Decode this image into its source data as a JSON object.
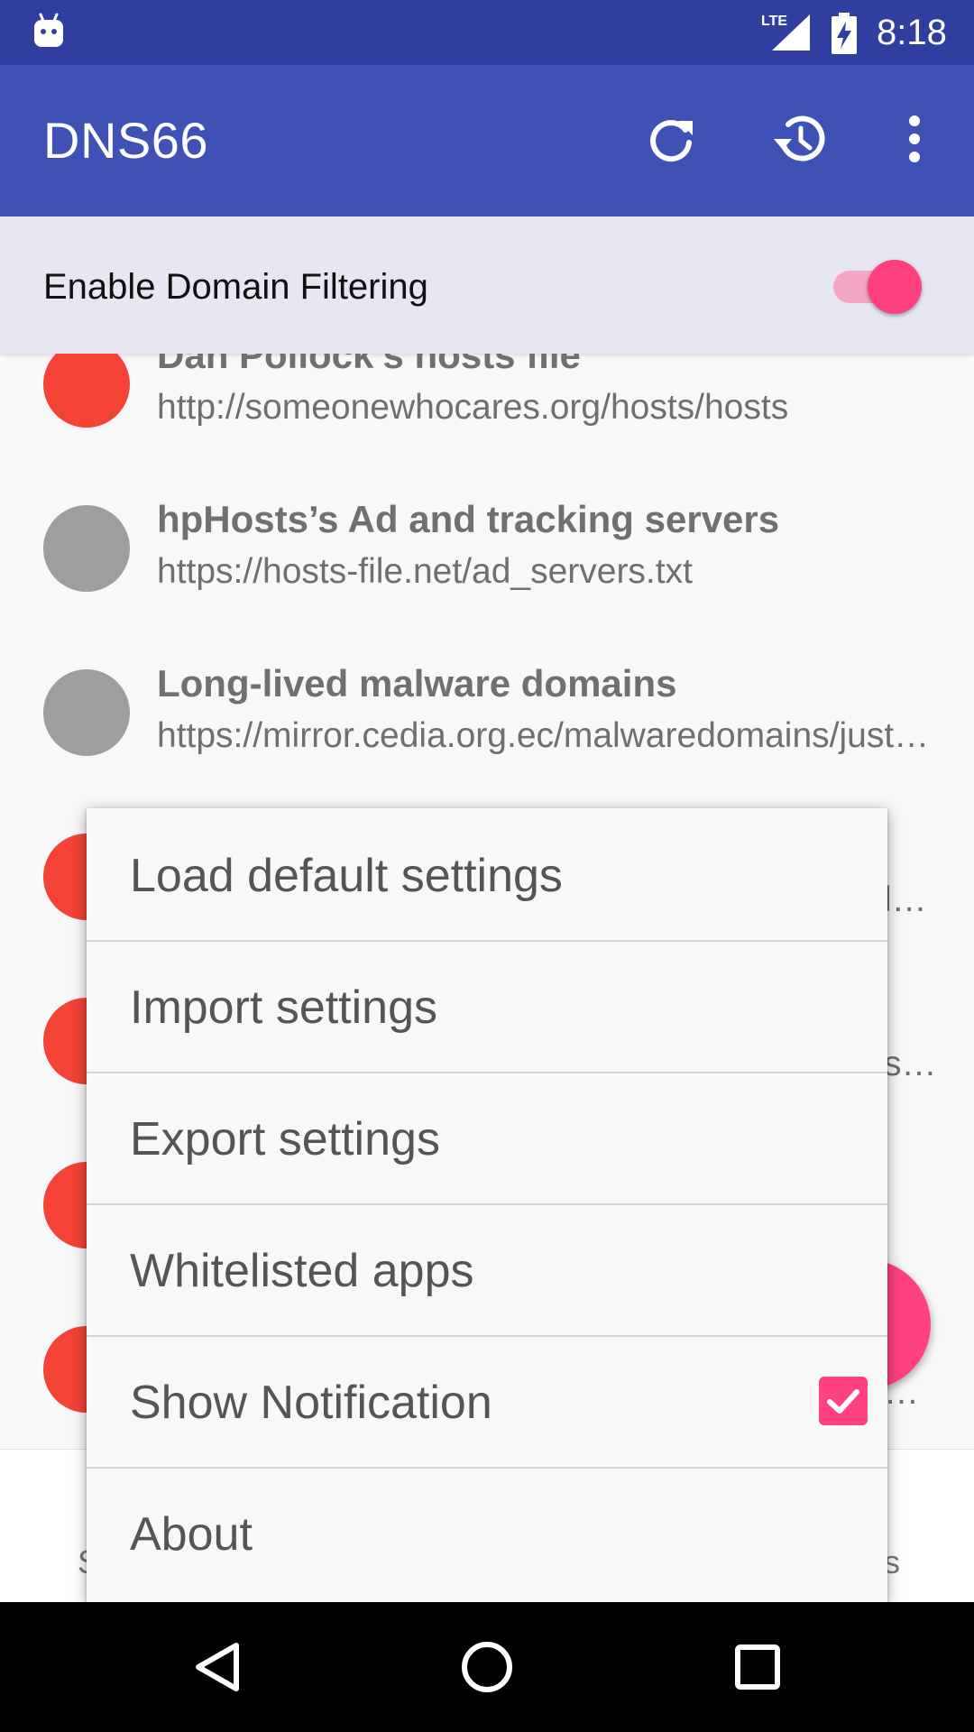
{
  "status_bar": {
    "time": "8:18",
    "network": "LTE",
    "icons": [
      "android-robot-icon",
      "lte-signal-icon",
      "battery-charging-icon"
    ]
  },
  "app_bar": {
    "title": "DNS66",
    "actions": [
      "refresh-icon",
      "history-icon",
      "overflow-menu-icon"
    ]
  },
  "filter_toggle": {
    "label": "Enable Domain Filtering",
    "enabled": true
  },
  "host_list": [
    {
      "title": "Dan Pollock’s hosts file",
      "url": "http://someonewhocares.org/hosts/hosts",
      "color": "#F44336"
    },
    {
      "title": "hpHosts’s Ad and tracking servers",
      "url": "https://hosts-file.net/ad_servers.txt",
      "color": "#9E9E9E"
    },
    {
      "title": "Long-lived malware domains",
      "url": "https://mirror.cedia.org.ec/malwaredomains/justdomains",
      "color": "#9E9E9E"
    },
    {
      "title": "",
      "url": "l…",
      "color": "#F44336"
    },
    {
      "title": "",
      "url": "s…",
      "color": "#F44336"
    },
    {
      "title": "",
      "url": "",
      "color": "#F44336"
    },
    {
      "title": "",
      "url": "…",
      "color": "#F44336"
    }
  ],
  "bottom_tabs": {
    "left": "S",
    "right": "s"
  },
  "overflow_menu": {
    "items": [
      {
        "label": "Load default settings"
      },
      {
        "label": "Import settings"
      },
      {
        "label": "Export settings"
      },
      {
        "label": "Whitelisted apps"
      },
      {
        "label": "Show Notification",
        "checked": true
      },
      {
        "label": "About"
      }
    ]
  },
  "nav_bar": {
    "buttons": [
      "back-icon",
      "home-icon",
      "recents-icon"
    ]
  },
  "colors": {
    "primary": "#3F51B5",
    "primary_dark": "#303F9F",
    "accent": "#FF4081"
  }
}
